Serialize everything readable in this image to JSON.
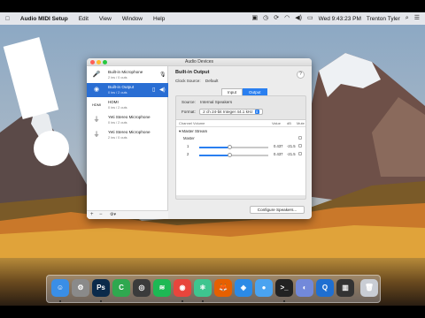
{
  "menubar": {
    "apple_icon": "apple-icon",
    "items": [
      "Audio MIDI Setup",
      "Edit",
      "View",
      "Window",
      "Help"
    ],
    "clock": "Wed 9:43:23 PM",
    "user": "Trenton Tyler",
    "status_icons": [
      "screen-record-icon",
      "clock-icon",
      "sync-icon",
      "wifi-icon",
      "volume-icon",
      "battery-icon",
      "search-icon",
      "list-icon"
    ]
  },
  "window": {
    "title": "Audio Devices",
    "devices": [
      {
        "name": "Built-in Microphone",
        "sub": "2 ins / 0 outs",
        "icon": "microphone-icon",
        "selected": false
      },
      {
        "name": "Built-in Output",
        "sub": "0 ins / 2 outs",
        "icon": "speaker-icon",
        "selected": true
      },
      {
        "name": "HDMI",
        "sub": "0 ins / 2 outs",
        "icon": "hdmi-icon",
        "selected": false
      },
      {
        "name": "Yeti Stereo Microphone",
        "sub": "0 ins / 2 outs",
        "icon": "usb-icon",
        "selected": false
      },
      {
        "name": "Yeti Stereo Microphone",
        "sub": "2 ins / 0 outs",
        "icon": "usb-icon",
        "selected": false
      }
    ],
    "sidebar_footer": {
      "add": "+",
      "remove": "−",
      "gear": "⚙▾"
    },
    "detail": {
      "device_title": "Built-in Output",
      "clock_source_label": "Clock Source:",
      "clock_source_value": "Default",
      "help": "?",
      "tabs": [
        "Input",
        "Output"
      ],
      "active_tab": "Output",
      "source_label": "Source:",
      "source_value": "Internal Speakers",
      "format_label": "Format:",
      "format_value": "2 ch 24-bit Integer 44.1 kHz",
      "table_headers": {
        "channel": "Channel Volume",
        "value": "Value",
        "db": "dB",
        "mute": "Mute"
      },
      "master_stream": "▾ Master Stream",
      "rows": [
        {
          "label": "Master",
          "value": "",
          "db": "",
          "level": null
        },
        {
          "label": "1",
          "value": "0.437",
          "db": "-21.5",
          "level": 0.437
        },
        {
          "label": "2",
          "value": "0.437",
          "db": "-21.5",
          "level": 0.437
        }
      ],
      "configure_button": "Configure Speakers..."
    }
  },
  "dock": {
    "apps": [
      {
        "name": "finder-icon",
        "glyph": "☺",
        "color": "#3a8ee6",
        "running": true
      },
      {
        "name": "system-preferences-icon",
        "glyph": "⚙",
        "color": "#8a8a8a",
        "running": false
      },
      {
        "name": "photoshop-icon",
        "glyph": "Ps",
        "color": "#0b2a4a",
        "running": true
      },
      {
        "name": "camtasia-icon",
        "glyph": "C",
        "color": "#2fa84f",
        "running": false
      },
      {
        "name": "motion-icon",
        "glyph": "◎",
        "color": "#3b3b3b",
        "running": false
      },
      {
        "name": "spotify-icon",
        "glyph": "≋",
        "color": "#1db954",
        "running": false
      },
      {
        "name": "chrome-icon",
        "glyph": "◉",
        "color": "#e8453c",
        "running": true
      },
      {
        "name": "atom-icon",
        "glyph": "⚛",
        "color": "#3ec58f",
        "running": true
      },
      {
        "name": "firefox-icon",
        "glyph": "🦊",
        "color": "#e66000",
        "running": false
      },
      {
        "name": "safari-icon",
        "glyph": "◈",
        "color": "#2b8ae6",
        "running": false
      },
      {
        "name": "messages-icon",
        "glyph": "●",
        "color": "#4aa3f0",
        "running": false
      },
      {
        "name": "terminal-icon",
        "glyph": ">_",
        "color": "#222",
        "running": true
      },
      {
        "name": "discord-icon",
        "glyph": "◐",
        "color": "#7289da",
        "running": false
      },
      {
        "name": "quicktime-icon",
        "glyph": "Q",
        "color": "#1f6fd1",
        "running": false
      },
      {
        "name": "piano-icon",
        "glyph": "▥",
        "color": "#333",
        "running": false
      },
      {
        "name": "trash-icon",
        "glyph": "🗑",
        "color": "#c9cdd4",
        "running": false
      }
    ]
  }
}
